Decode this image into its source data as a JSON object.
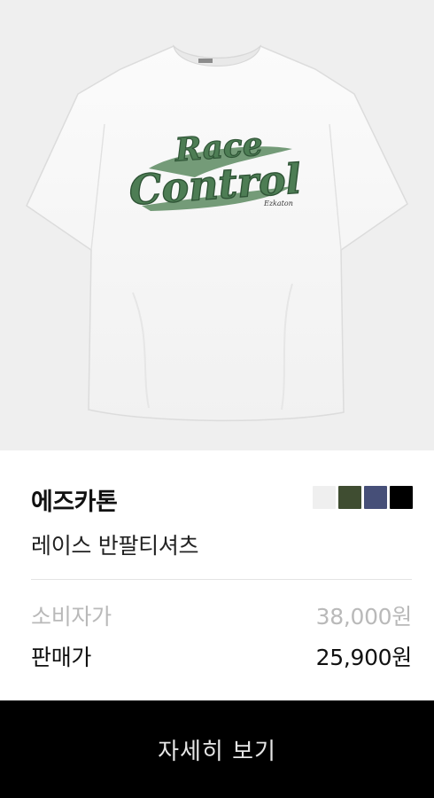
{
  "product": {
    "brand": "에즈카톤",
    "name": "레이스 반팔티셔츠",
    "image_text": {
      "graphic_line1": "Race",
      "graphic_line2": "Control",
      "graphic_signature": "Ezkaton"
    },
    "color_swatches": [
      {
        "name": "white",
        "color": "#efefef"
      },
      {
        "name": "khaki",
        "color": "#3f4d31"
      },
      {
        "name": "navy",
        "color": "#464f78"
      },
      {
        "name": "black",
        "color": "#000000"
      }
    ]
  },
  "pricing": {
    "msrp_label": "소비자가",
    "msrp_value": "38,000원",
    "sale_label": "판매가",
    "sale_value": "25,900원"
  },
  "actions": {
    "detail_button": "자세히 보기"
  },
  "colors": {
    "image_bg": "#efefef",
    "graphic_green": "#4d7d54",
    "button_bg": "#000000"
  }
}
